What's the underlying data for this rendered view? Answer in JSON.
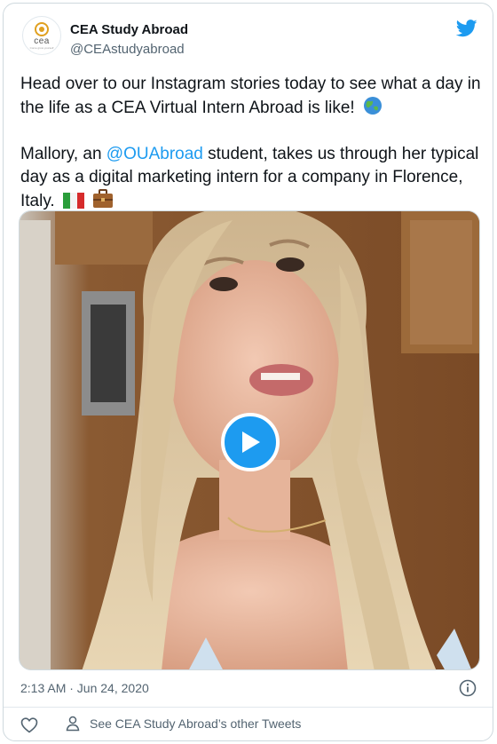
{
  "author": {
    "name": "CEA Study Abroad",
    "handle": "@CEAstudyabroad",
    "avatar_brand": "cea",
    "avatar_tagline": "Come grow yourself"
  },
  "tweet": {
    "paragraph1": "Head over to our Instagram stories today to see what a day in the life as a CEA Virtual Intern Abroad is like!",
    "paragraph2_prefix": "Mallory, an ",
    "mention": "@OUAbroad",
    "paragraph2_suffix": " student, takes us through her typical day as a digital marketing intern for a company in Florence, Italy.",
    "emojis": [
      "globe-emoji",
      "italy-flag-emoji",
      "briefcase-emoji"
    ]
  },
  "media": {
    "type": "video",
    "play_icon": "play-icon"
  },
  "footer": {
    "timestamp": "2:13 AM · Jun 24, 2020",
    "other_tweets_label": "See CEA Study Abroad’s other Tweets"
  },
  "colors": {
    "accent": "#1d9bf0",
    "text": "#0f1419",
    "secondary": "#536471",
    "border": "#cfd9de"
  }
}
